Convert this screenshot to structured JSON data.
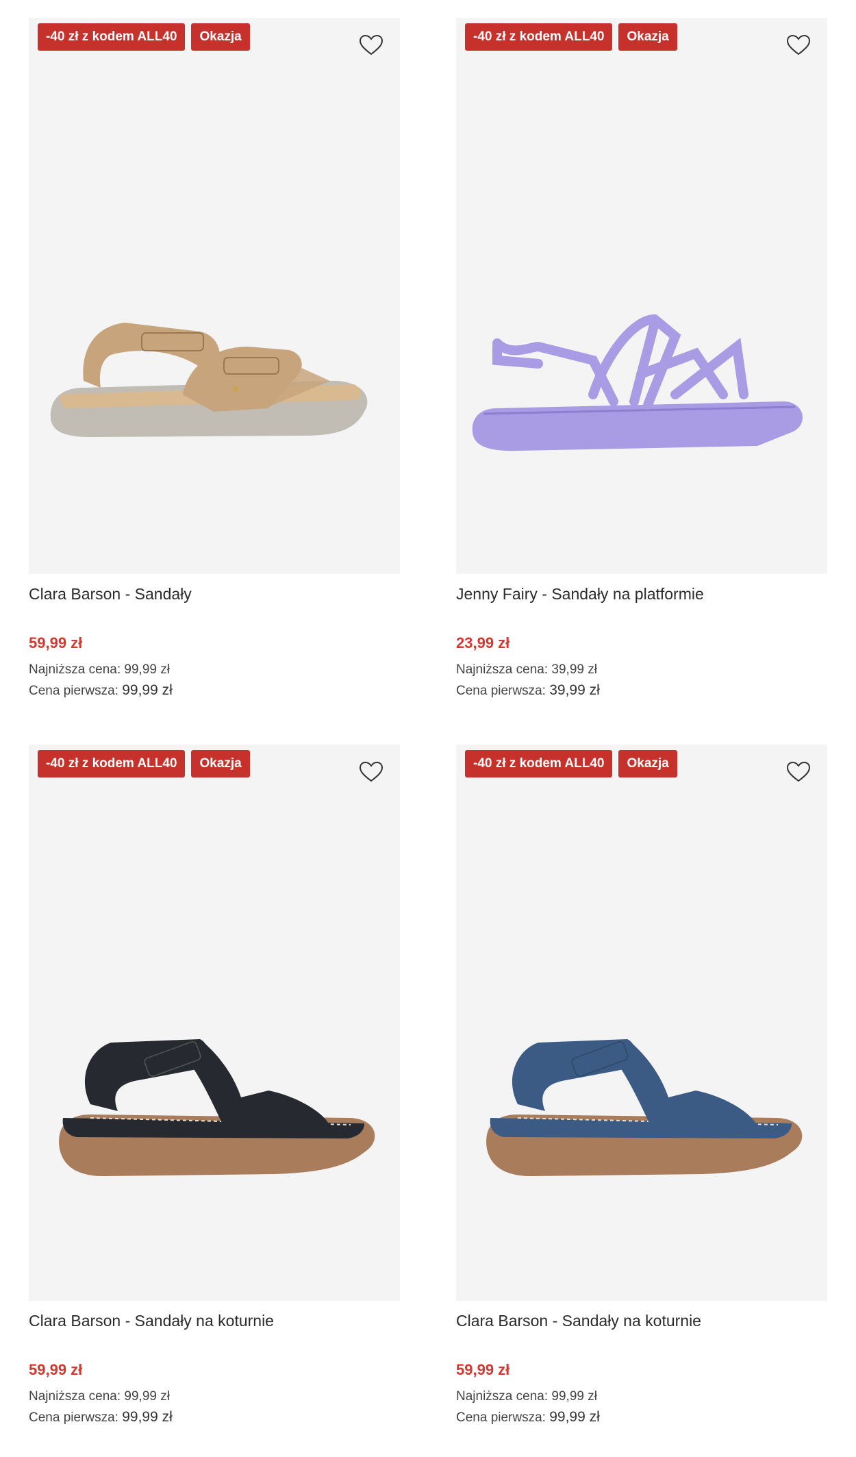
{
  "products": [
    {
      "badge_promo": "-40 zł z kodem ALL40",
      "badge_deal": "Okazja",
      "title": "Clara Barson - Sandały",
      "price": "59,99 zł",
      "lowest_label": "Najniższa cena:",
      "lowest_value": "99,99 zł",
      "first_label": "Cena pierwsza:",
      "first_value": "99,99 zł",
      "shoe_color": "#c8a47c"
    },
    {
      "badge_promo": "-40 zł z kodem ALL40",
      "badge_deal": "Okazja",
      "title": "Jenny Fairy - Sandały na platformie",
      "price": "23,99 zł",
      "lowest_label": "Najniższa cena:",
      "lowest_value": "39,99 zł",
      "first_label": "Cena pierwsza:",
      "first_value": "39,99 zł",
      "shoe_color": "#a99be4"
    },
    {
      "badge_promo": "-40 zł z kodem ALL40",
      "badge_deal": "Okazja",
      "title": "Clara Barson - Sandały na koturnie",
      "price": "59,99 zł",
      "lowest_label": "Najniższa cena:",
      "lowest_value": "99,99 zł",
      "first_label": "Cena pierwsza:",
      "first_value": "99,99 zł",
      "shoe_color": "#262a30"
    },
    {
      "badge_promo": "-40 zł z kodem ALL40",
      "badge_deal": "Okazja",
      "title": "Clara Barson - Sandały na koturnie",
      "price": "59,99 zł",
      "lowest_label": "Najniższa cena:",
      "lowest_value": "99,99 zł",
      "first_label": "Cena pierwsza:",
      "first_value": "99,99 zł",
      "shoe_color": "#3b5b85"
    }
  ],
  "colors": {
    "badge": "#c7312c",
    "price": "#d03a33",
    "image_bg": "#f4f4f4"
  },
  "icons": {
    "favorite": "heart-outline-icon"
  }
}
